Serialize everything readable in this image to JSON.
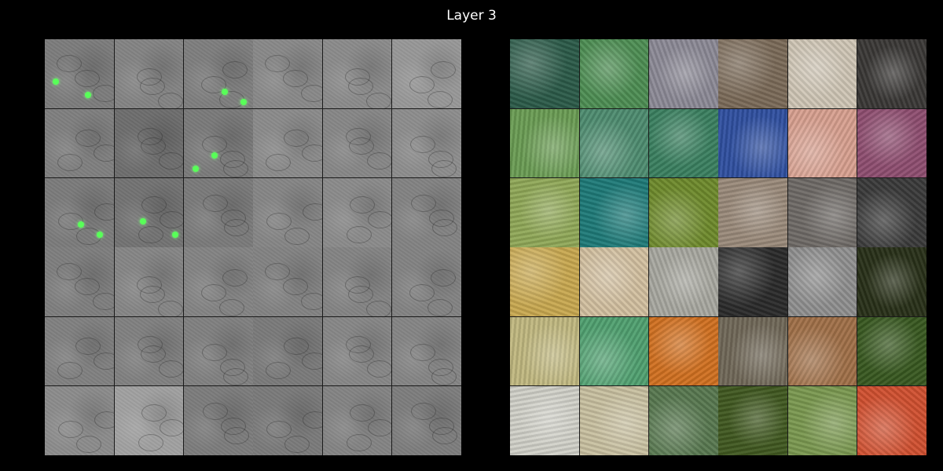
{
  "title": "Layer 3",
  "left_panel": {
    "groups": [
      {
        "shade": [
          "#7c7c7c",
          "#838383",
          "#7e7e7e",
          "#7f7f7f",
          "#6d6d6d",
          "#7a7a7a",
          "#7b7b7b",
          "#727272",
          "#7a7a7a"
        ],
        "hot": [
          true,
          false,
          true,
          false,
          false,
          true,
          true,
          true,
          false
        ]
      },
      {
        "shade": [
          "#888888",
          "#8a8a8a",
          "#979797",
          "#8a8a8a",
          "#868686",
          "#8c8c8c",
          "#858585",
          "#8a8a8a",
          "#828282"
        ],
        "hot": [
          false,
          false,
          false,
          false,
          false,
          false,
          false,
          false,
          false
        ]
      },
      {
        "shade": [
          "#7e7e7e",
          "#858585",
          "#838383",
          "#808080",
          "#808080",
          "#808080",
          "#8b8b8b",
          "#a0a0a0",
          "#7c7c7c"
        ],
        "hot": [
          false,
          false,
          false,
          false,
          false,
          false,
          false,
          false,
          false
        ]
      },
      {
        "shade": [
          "#828282",
          "#838383",
          "#828282",
          "#7a7a7a",
          "#868686",
          "#848484",
          "#7a7a7a",
          "#838383",
          "#7d7d7d"
        ],
        "hot": [
          false,
          false,
          false,
          false,
          false,
          false,
          false,
          false,
          false
        ]
      }
    ]
  },
  "right_panel": {
    "groups": [
      {
        "colors": [
          "#2b5a48",
          "#4e8e54",
          "#8c8a96",
          "#6a9c54",
          "#4e8c70",
          "#3a8060",
          "#90a858",
          "#1e7a78",
          "#6e8a2c"
        ]
      },
      {
        "colors": [
          "#7a6a58",
          "#cfc6b6",
          "#3a3836",
          "#3050a0",
          "#d8a090",
          "#8e4e70",
          "#9a8a7a",
          "#6e6a66",
          "#3a3a3a"
        ]
      },
      {
        "colors": [
          "#c8a850",
          "#d2c0a0",
          "#a8a8a0",
          "#c0b880",
          "#50a070",
          "#d07020",
          "#d0d0c8",
          "#c8c0a0",
          "#587850"
        ]
      },
      {
        "colors": [
          "#2a2a2a",
          "#909090",
          "#283018",
          "#706858",
          "#a07048",
          "#385820",
          "#405820",
          "#7a9850",
          "#d05030"
        ]
      }
    ]
  }
}
